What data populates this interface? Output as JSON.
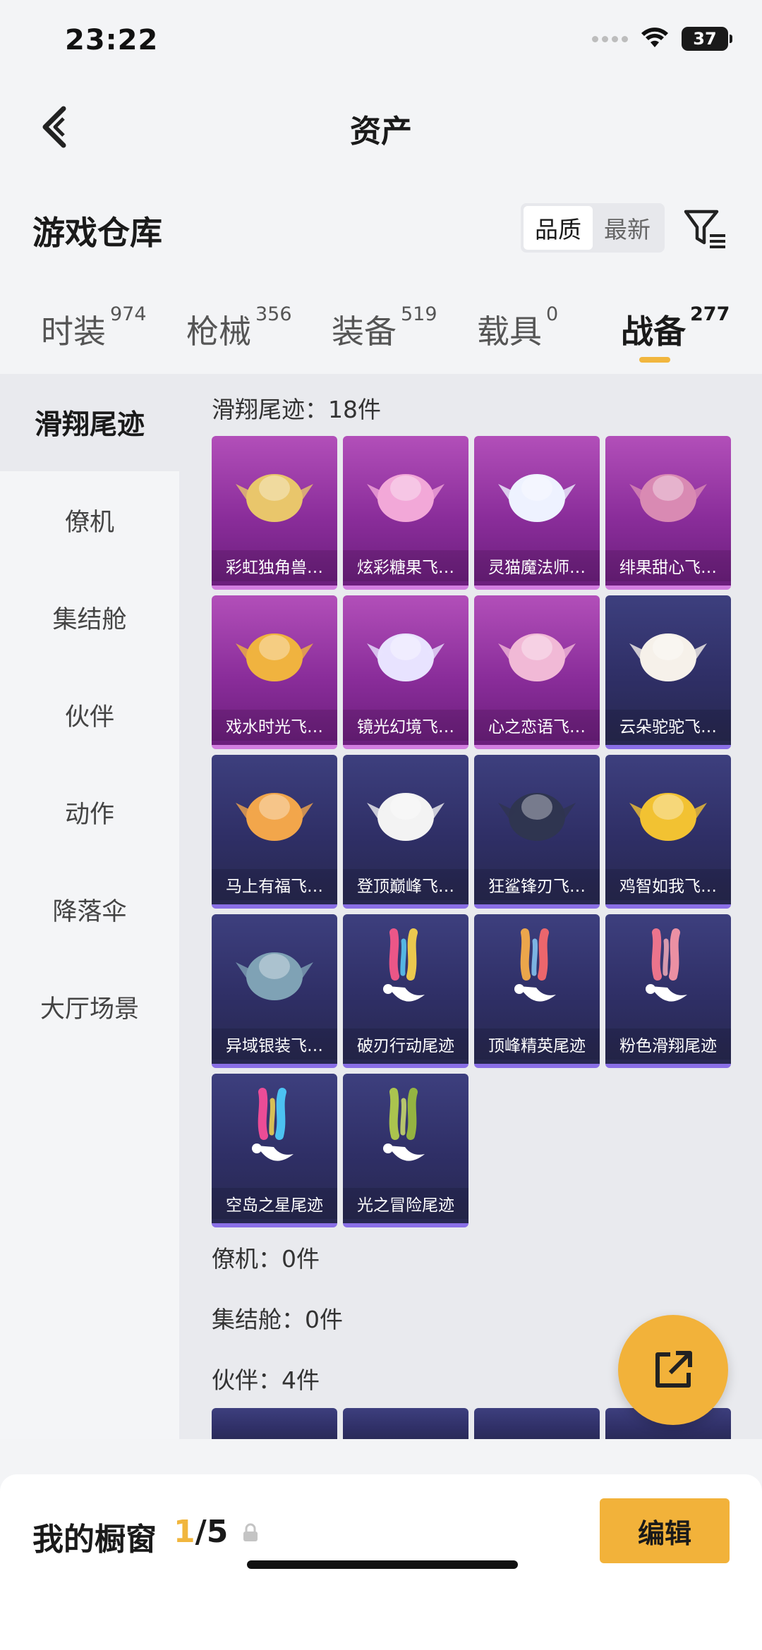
{
  "status": {
    "time": "23:22",
    "battery": "37"
  },
  "nav": {
    "title": "资产"
  },
  "header": {
    "title": "游戏仓库",
    "sort_options": [
      "品质",
      "最新"
    ]
  },
  "tabs": [
    {
      "label": "时装",
      "count": "974"
    },
    {
      "label": "枪械",
      "count": "356"
    },
    {
      "label": "装备",
      "count": "519"
    },
    {
      "label": "载具",
      "count": "0"
    },
    {
      "label": "战备",
      "count": "277"
    }
  ],
  "sidebar": [
    "滑翔尾迹",
    "僚机",
    "集结舱",
    "伙伴",
    "动作",
    "降落伞",
    "大厅场景"
  ],
  "groups": {
    "trail": "滑翔尾迹：18件",
    "wingman": "僚机：0件",
    "pod": "集结舱：0件",
    "partner": "伙伴：4件"
  },
  "items": [
    {
      "name": "彩虹独角兽…",
      "rarity": "purple",
      "icon": "unicorn-emblem-icon"
    },
    {
      "name": "炫彩糖果飞…",
      "rarity": "purple",
      "icon": "candy-wing-icon"
    },
    {
      "name": "灵猫魔法师…",
      "rarity": "purple",
      "icon": "cat-icon"
    },
    {
      "name": "绯果甜心飞…",
      "rarity": "purple",
      "icon": "bunny-mask-icon"
    },
    {
      "name": "戏水时光飞…",
      "rarity": "purple",
      "icon": "giraffe-float-icon"
    },
    {
      "name": "镜光幻境飞…",
      "rarity": "purple",
      "icon": "crystal-wing-icon"
    },
    {
      "name": "心之恋语飞…",
      "rarity": "purple",
      "icon": "butterfly-icon"
    },
    {
      "name": "云朵驼驼飞…",
      "rarity": "blue",
      "icon": "alpaca-icon"
    },
    {
      "name": "马上有福飞…",
      "rarity": "blue",
      "icon": "horse-toy-icon"
    },
    {
      "name": "登顶巅峰飞…",
      "rarity": "blue",
      "icon": "jet-glider-icon"
    },
    {
      "name": "狂鲨锋刃飞…",
      "rarity": "blue",
      "icon": "shark-glider-icon"
    },
    {
      "name": "鸡智如我飞…",
      "rarity": "blue",
      "icon": "chicken-icon"
    },
    {
      "name": "异域银装飞…",
      "rarity": "blue",
      "icon": "silver-wing-icon"
    },
    {
      "name": "破刃行动尾迹",
      "rarity": "blue",
      "icon": "trail-rainbow-icon"
    },
    {
      "name": "顶峰精英尾迹",
      "rarity": "blue",
      "icon": "trail-fire-icon"
    },
    {
      "name": "粉色滑翔尾迹",
      "rarity": "blue",
      "icon": "trail-pink-icon"
    },
    {
      "name": "空岛之星尾迹",
      "rarity": "blue",
      "icon": "trail-spectrum-icon"
    },
    {
      "name": "光之冒险尾迹",
      "rarity": "blue",
      "icon": "trail-green-icon"
    }
  ],
  "showcase": {
    "label": "我的橱窗",
    "current": "1",
    "total": "/5"
  },
  "edit_label": "编辑"
}
